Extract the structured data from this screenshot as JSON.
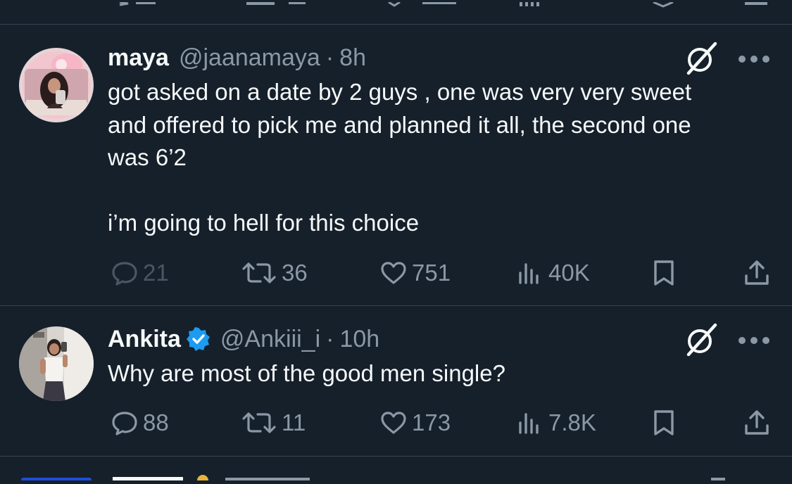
{
  "tweets": [
    {
      "name": "maya",
      "handle": "@jaanamaya",
      "separator": "·",
      "time": "8h",
      "verified": false,
      "text": "got asked on a date by 2 guys , one was very very sweet\nand offered to pick me and planned it all, the second one\nwas 6’2\n\ni’m going to hell for this choice",
      "replies": "21",
      "reposts": "36",
      "likes": "751",
      "views": "40K"
    },
    {
      "name": "Ankita",
      "handle": "@Ankiii_i",
      "separator": "·",
      "time": "10h",
      "verified": true,
      "text": "Why are most of the good men single?",
      "replies": "88",
      "reposts": "11",
      "likes": "173",
      "views": "7.8K"
    }
  ],
  "icons": {
    "reply": "speech-bubble-icon",
    "repost": "repost-arrows-icon",
    "like": "heart-icon",
    "views": "bar-chart-icon",
    "bookmark": "bookmark-icon",
    "share": "share-upload-icon",
    "grok": "grok-slash-icon",
    "more": "more-dots-icon",
    "verified": "verified-badge-icon"
  },
  "colors": {
    "background": "#15202b",
    "text": "#f7f9f9",
    "secondary": "#8b98a5",
    "divider": "#38444d",
    "verified": "#1d9bf0"
  }
}
